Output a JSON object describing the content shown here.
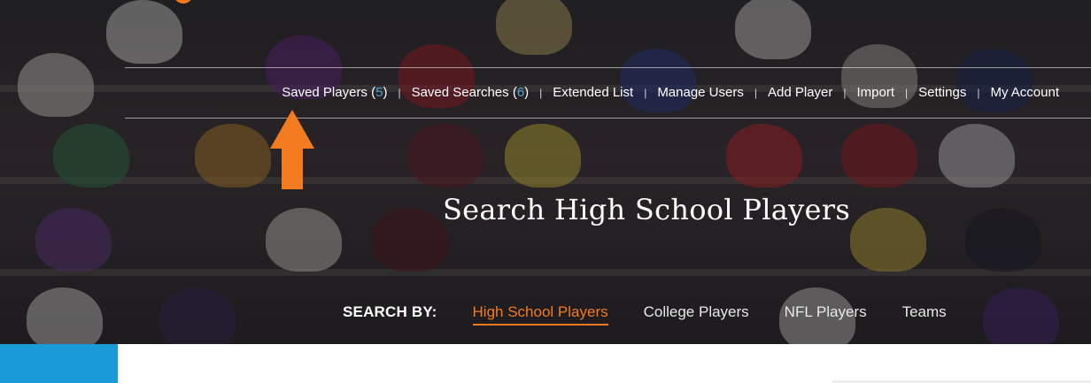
{
  "nav": {
    "items": [
      {
        "label": "Saved Players (",
        "count": "5",
        "suffix": ")"
      },
      {
        "label": "Saved Searches (",
        "count": "6",
        "suffix": ")"
      },
      {
        "label": "Extended List"
      },
      {
        "label": "Manage Users"
      },
      {
        "label": "Add Player"
      },
      {
        "label": "Import"
      },
      {
        "label": "Settings"
      },
      {
        "label": "My Account"
      }
    ],
    "separator": "|"
  },
  "hero": {
    "title": "Search High School Players"
  },
  "search_by": {
    "label": "SEARCH BY:",
    "options": [
      "High School Players",
      "College Players",
      "NFL Players",
      "Teams"
    ],
    "active": "High School Players"
  },
  "colors": {
    "accent": "#f47a20",
    "count": "#4aa3d8",
    "panel": "#1a9bd7"
  },
  "icons": {
    "annotation_arrow": "up-arrow-icon",
    "panel_toggle": "chevron-down-icon"
  }
}
